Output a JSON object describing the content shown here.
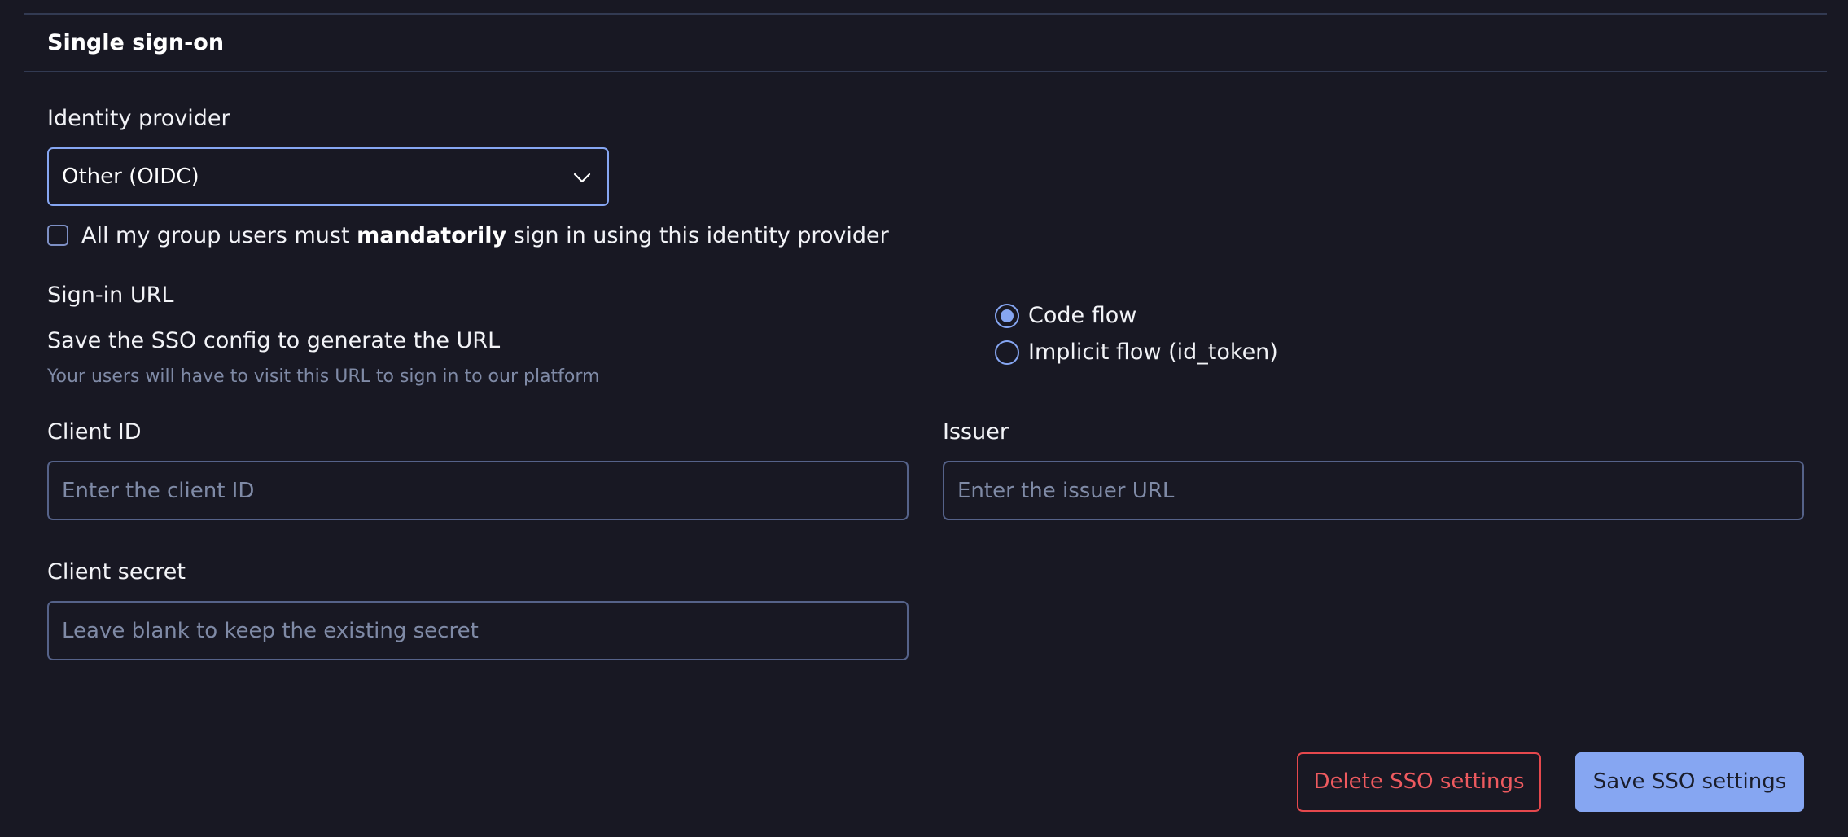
{
  "section": {
    "title": "Single sign-on"
  },
  "identity_provider": {
    "label": "Identity provider",
    "selected": "Other (OIDC)"
  },
  "mandatory_checkbox": {
    "checked": false,
    "text_before": "All my group users must ",
    "text_bold": "mandatorily",
    "text_after": " sign in using this identity provider"
  },
  "sign_in_url": {
    "label": "Sign-in URL",
    "value": "Save the SSO config to generate the URL",
    "hint": "Your users will have to visit this URL to sign in to our platform"
  },
  "flow": {
    "options": [
      {
        "label": "Code flow",
        "checked": true
      },
      {
        "label": "Implicit flow (id_token)",
        "checked": false
      }
    ]
  },
  "client_id": {
    "label": "Client ID",
    "value": "",
    "placeholder": "Enter the client ID"
  },
  "issuer": {
    "label": "Issuer",
    "value": "",
    "placeholder": "Enter the issuer URL"
  },
  "client_secret": {
    "label": "Client secret",
    "value": "",
    "placeholder": "Leave blank to keep the existing secret"
  },
  "actions": {
    "delete_label": "Delete SSO settings",
    "save_label": "Save SSO settings"
  },
  "colors": {
    "background": "#181823",
    "accent": "#86a6f2",
    "danger": "#e5484d",
    "border": "#556289",
    "muted_text": "#7f8aa6"
  },
  "icons": {
    "select_chevron": "chevron-down-icon"
  }
}
